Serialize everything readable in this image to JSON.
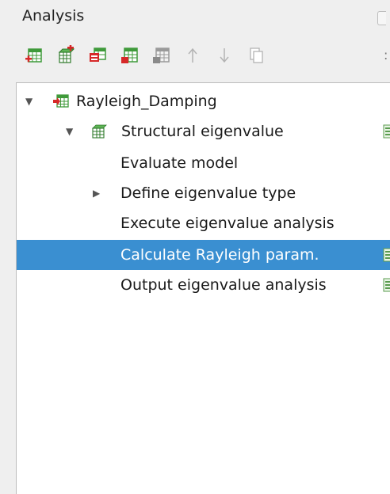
{
  "panel": {
    "title": "Analysis"
  },
  "toolbar": {
    "buttons": [
      {
        "name": "add-analysis-button",
        "icon": "add-analysis-icon"
      },
      {
        "name": "add-structural-analysis-button",
        "icon": "add-grid-icon"
      },
      {
        "name": "rename-analysis-button",
        "icon": "analysis-rename-icon"
      },
      {
        "name": "export-analysis-button",
        "icon": "analysis-export-icon"
      },
      {
        "name": "disabled-analysis-button",
        "icon": "analysis-gray-icon"
      },
      {
        "name": "move-up-button",
        "icon": "arrow-up-icon"
      },
      {
        "name": "move-down-button",
        "icon": "arrow-down-icon"
      },
      {
        "name": "copy-button",
        "icon": "copy-icon"
      }
    ]
  },
  "tree": {
    "root": {
      "label": "Rayleigh_Damping",
      "expanded": true
    },
    "analysis": {
      "label": "Structural eigenvalue",
      "expanded": true
    },
    "items": [
      {
        "label": "Evaluate model",
        "has_children": false,
        "selected": false
      },
      {
        "label": "Define eigenvalue type",
        "has_children": true,
        "selected": false
      },
      {
        "label": "Execute eigenvalue analysis",
        "has_children": false,
        "selected": false
      },
      {
        "label": "Calculate Rayleigh param.",
        "has_children": false,
        "selected": true
      },
      {
        "label": "Output eigenvalue analysis",
        "has_children": false,
        "selected": false
      }
    ]
  },
  "colors": {
    "selection": "#3a8fd1",
    "panel_bg": "#efefef",
    "tree_bg": "#ffffff",
    "icon_green": "#3f9a3a",
    "icon_red": "#d62828"
  }
}
